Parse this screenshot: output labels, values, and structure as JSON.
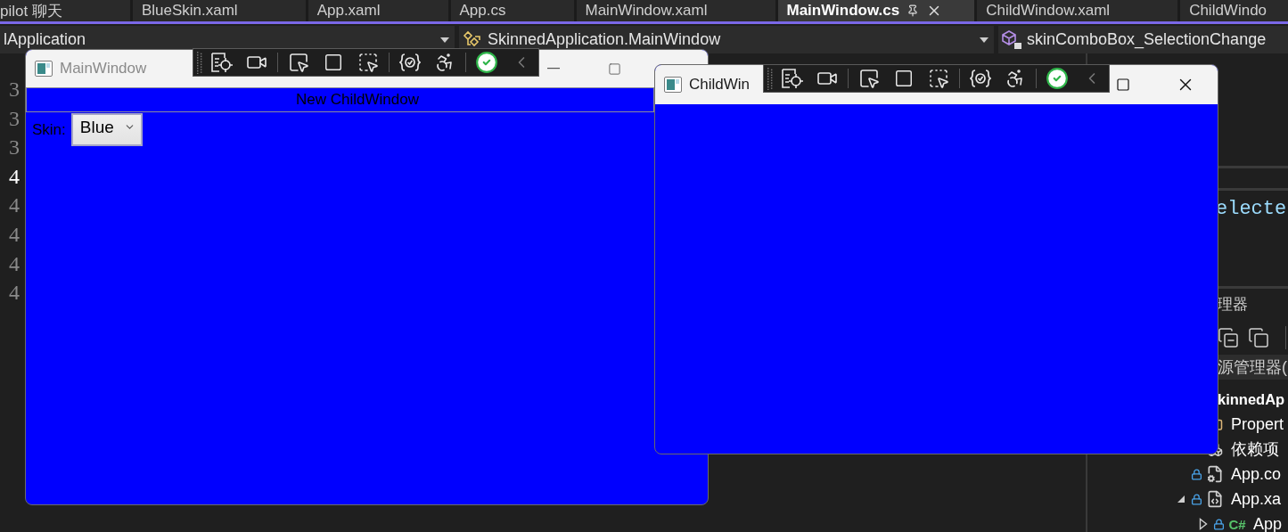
{
  "tabs": [
    {
      "label": "pilot 聊天",
      "selected": false
    },
    {
      "label": "BlueSkin.xaml",
      "selected": false
    },
    {
      "label": "App.xaml",
      "selected": false
    },
    {
      "label": "App.cs",
      "selected": false
    },
    {
      "label": "MainWindow.xaml",
      "selected": false
    },
    {
      "label": "MainWindow.cs",
      "selected": true
    },
    {
      "label": "ChildWindow.xaml",
      "selected": false
    },
    {
      "label": "ChildWindo",
      "selected": false
    }
  ],
  "nav_bar": {
    "project": "lApplication",
    "type": "SkinnedApplication.MainWindow",
    "member": "skinComboBox_SelectionChange"
  },
  "line_numbers": [
    {
      "text": "3",
      "current": false
    },
    {
      "text": "3",
      "current": false
    },
    {
      "text": "3",
      "current": false
    },
    {
      "text": "4",
      "current": true
    },
    {
      "text": "4",
      "current": false
    },
    {
      "text": "4",
      "current": false
    },
    {
      "text": "4",
      "current": false
    },
    {
      "text": "4",
      "current": false
    }
  ],
  "code_fragment": "electe",
  "solution_explorer": {
    "title": "理器",
    "search": "源管理器(",
    "tree": [
      {
        "label": "kinnedAp",
        "kind": "project",
        "children": [
          {
            "label": "Propert",
            "kind": "properties",
            "locked": false
          },
          {
            "label": "依赖项",
            "kind": "dependencies",
            "locked": false
          },
          {
            "label": "App.co",
            "kind": "config",
            "locked": true
          },
          {
            "label": "App.xa",
            "kind": "xaml",
            "locked": true,
            "expanded": true,
            "children": [
              {
                "label": "App",
                "kind": "csharp",
                "badge": "C#",
                "locked": true,
                "expanded": false
              }
            ]
          }
        ]
      }
    ]
  },
  "main_window": {
    "title": "MainWindow",
    "button": "New ChildWindow",
    "skin_label": "Skin:",
    "skin_value": "Blue"
  },
  "child_window": {
    "title": "ChildWin"
  }
}
